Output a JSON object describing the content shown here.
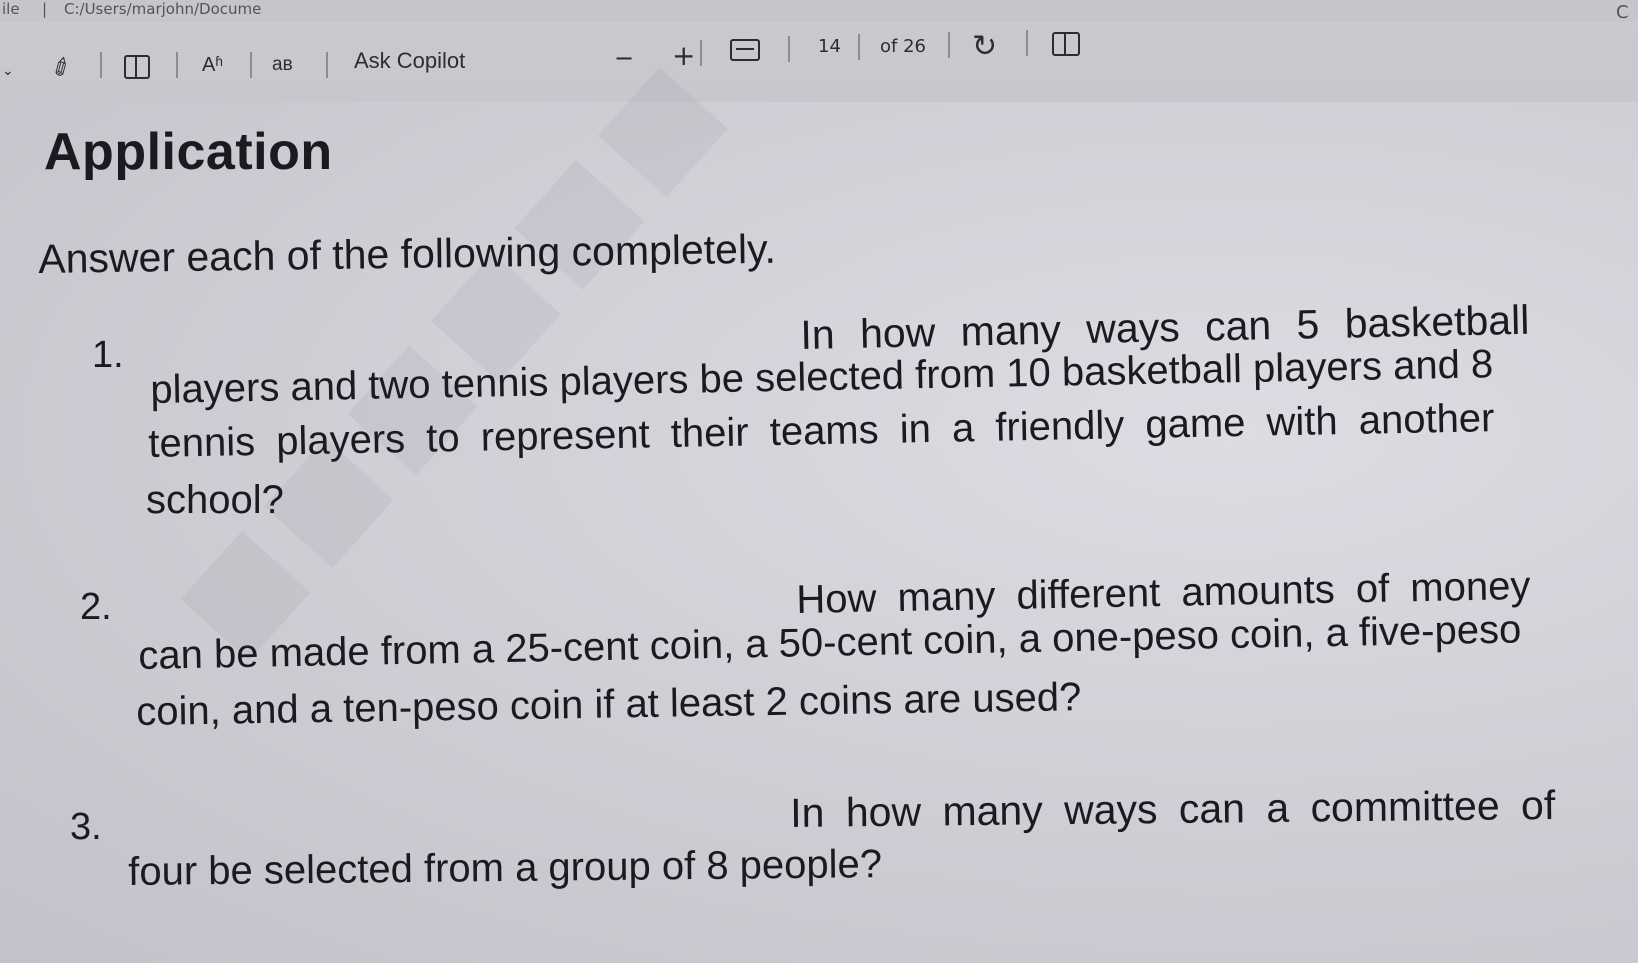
{
  "address_bar": {
    "file_tag": "ile",
    "separator": "|",
    "path": "C:/Users/marjohn/Docume",
    "refresh_icon": "C"
  },
  "toolbar": {
    "draw_icon_glyph": "✐",
    "read_aloud_label": "Aʱ",
    "translate_label": "aʙ",
    "ask_copilot_label": "Ask Copilot",
    "zoom_out_label": "−",
    "zoom_in_label": "+",
    "page_current": "14",
    "page_total_label": "of 26",
    "rotate_glyph": "↻"
  },
  "document": {
    "heading": "Application",
    "instructions": "Answer each of the following completely.",
    "questions": [
      {
        "number": "1.",
        "lines": [
          "In how many ways can 5 basketball",
          "players and two tennis players be selected from 10 basketball players and 8",
          "tennis players to represent their teams in a friendly game with another",
          "school?"
        ]
      },
      {
        "number": "2.",
        "lines": [
          "How many different amounts of money",
          "can be made from a 25-cent coin, a 50-cent coin, a one-peso coin, a five-peso",
          "coin, and a ten-peso coin if at least 2 coins are used?"
        ]
      },
      {
        "number": "3.",
        "lines": [
          "In how many ways can a committee of",
          "four be selected from a group of 8 people?"
        ]
      }
    ]
  }
}
